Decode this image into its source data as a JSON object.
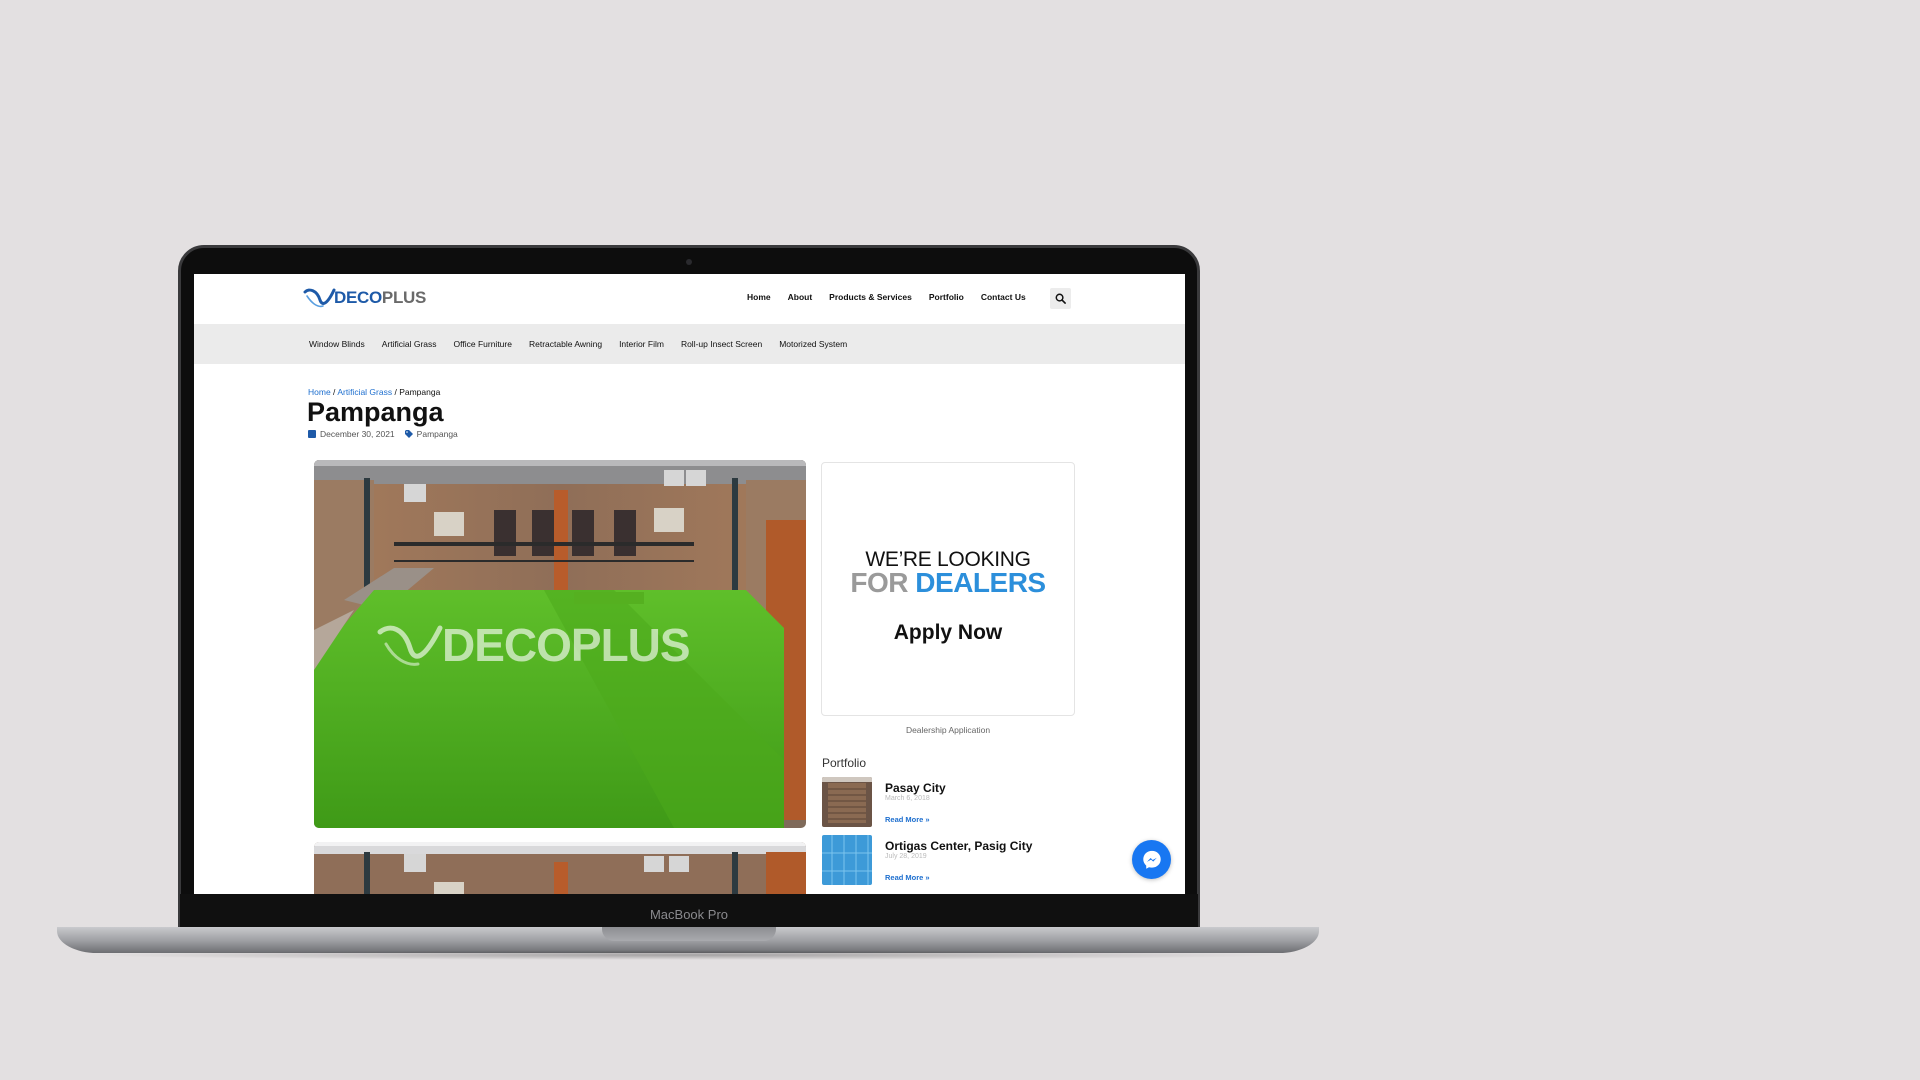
{
  "device": {
    "model_label": "MacBook Pro"
  },
  "site": {
    "logo": {
      "deco": "DECO",
      "plus": "PLUS"
    },
    "main_nav": [
      "Home",
      "About",
      "Products & Services",
      "Portfolio",
      "Contact Us"
    ],
    "search_icon": "search-icon",
    "sub_nav": [
      "Window Blinds",
      "Artificial Grass",
      "Office Furniture",
      "Retractable Awning",
      "Interior Film",
      "Roll-up Insect Screen",
      "Motorized System"
    ]
  },
  "post": {
    "breadcrumb": {
      "home": "Home",
      "sep1": " / ",
      "category": "Artificial Grass",
      "sep2": " / ",
      "current": "Pampanga"
    },
    "title": "Pampanga",
    "date": "December 30, 2021",
    "tag": "Pampanga",
    "watermark": "DECOPLUS"
  },
  "sidebar": {
    "banner": {
      "line1": "WE’RE LOOKING",
      "for": "FOR ",
      "dealers": "DEALERS",
      "cta": "Apply Now"
    },
    "banner_caption": "Dealership Application",
    "portfolio_heading": "Portfolio",
    "portfolio_items": [
      {
        "title": "Pasay City",
        "date": "March 6, 2018",
        "read_more": "Read More »"
      },
      {
        "title": "Ortigas Center, Pasig City",
        "date": "July 28, 2019",
        "read_more": "Read More »"
      }
    ]
  },
  "colors": {
    "brand_blue": "#1e5aa8",
    "accent_blue": "#2c8fdb",
    "messenger_blue": "#1877f2"
  }
}
